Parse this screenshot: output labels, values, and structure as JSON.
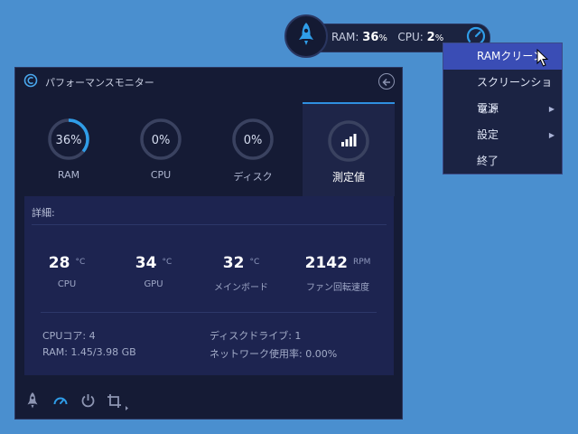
{
  "widget": {
    "ram_label": "RAM:",
    "ram_value": "36",
    "ram_unit": "%",
    "cpu_label": "CPU:",
    "cpu_value": "2",
    "cpu_unit": "%"
  },
  "context_menu": {
    "items": [
      {
        "label": "RAMクリーン",
        "submenu": false
      },
      {
        "label": "スクリーンショット",
        "submenu": false
      },
      {
        "label": "電源",
        "submenu": true
      },
      {
        "label": "設定",
        "submenu": true
      },
      {
        "label": "終了",
        "submenu": false
      }
    ],
    "submenu_arrow": "▶"
  },
  "window": {
    "title": "パフォーマンスモニター",
    "tabs": [
      {
        "percent": "36%",
        "label": "RAM",
        "fill": 0.36
      },
      {
        "percent": "0%",
        "label": "CPU",
        "fill": 0
      },
      {
        "percent": "0%",
        "label": "ディスク",
        "fill": 0
      },
      {
        "label": "測定値"
      }
    ],
    "details": {
      "heading": "詳細:",
      "metrics": [
        {
          "value": "28",
          "unit": "°C",
          "label": "CPU"
        },
        {
          "value": "34",
          "unit": "°C",
          "label": "GPU"
        },
        {
          "value": "32",
          "unit": "°C",
          "label": "メインボード"
        },
        {
          "value": "2142",
          "unit": "RPM",
          "label": "ファン回転速度"
        }
      ],
      "info": {
        "cpu_cores": "CPUコア:  4",
        "ram": "RAM:  1.45/3.98 GB",
        "disk_drives": "ディスクドライブ:  1",
        "network": "ネットワーク使用率:  0.00%"
      }
    }
  },
  "colors": {
    "accent": "#2f9de8",
    "background": "#4a8fcf",
    "panel": "#151b35",
    "menu_highlight": "#3a4db5"
  }
}
